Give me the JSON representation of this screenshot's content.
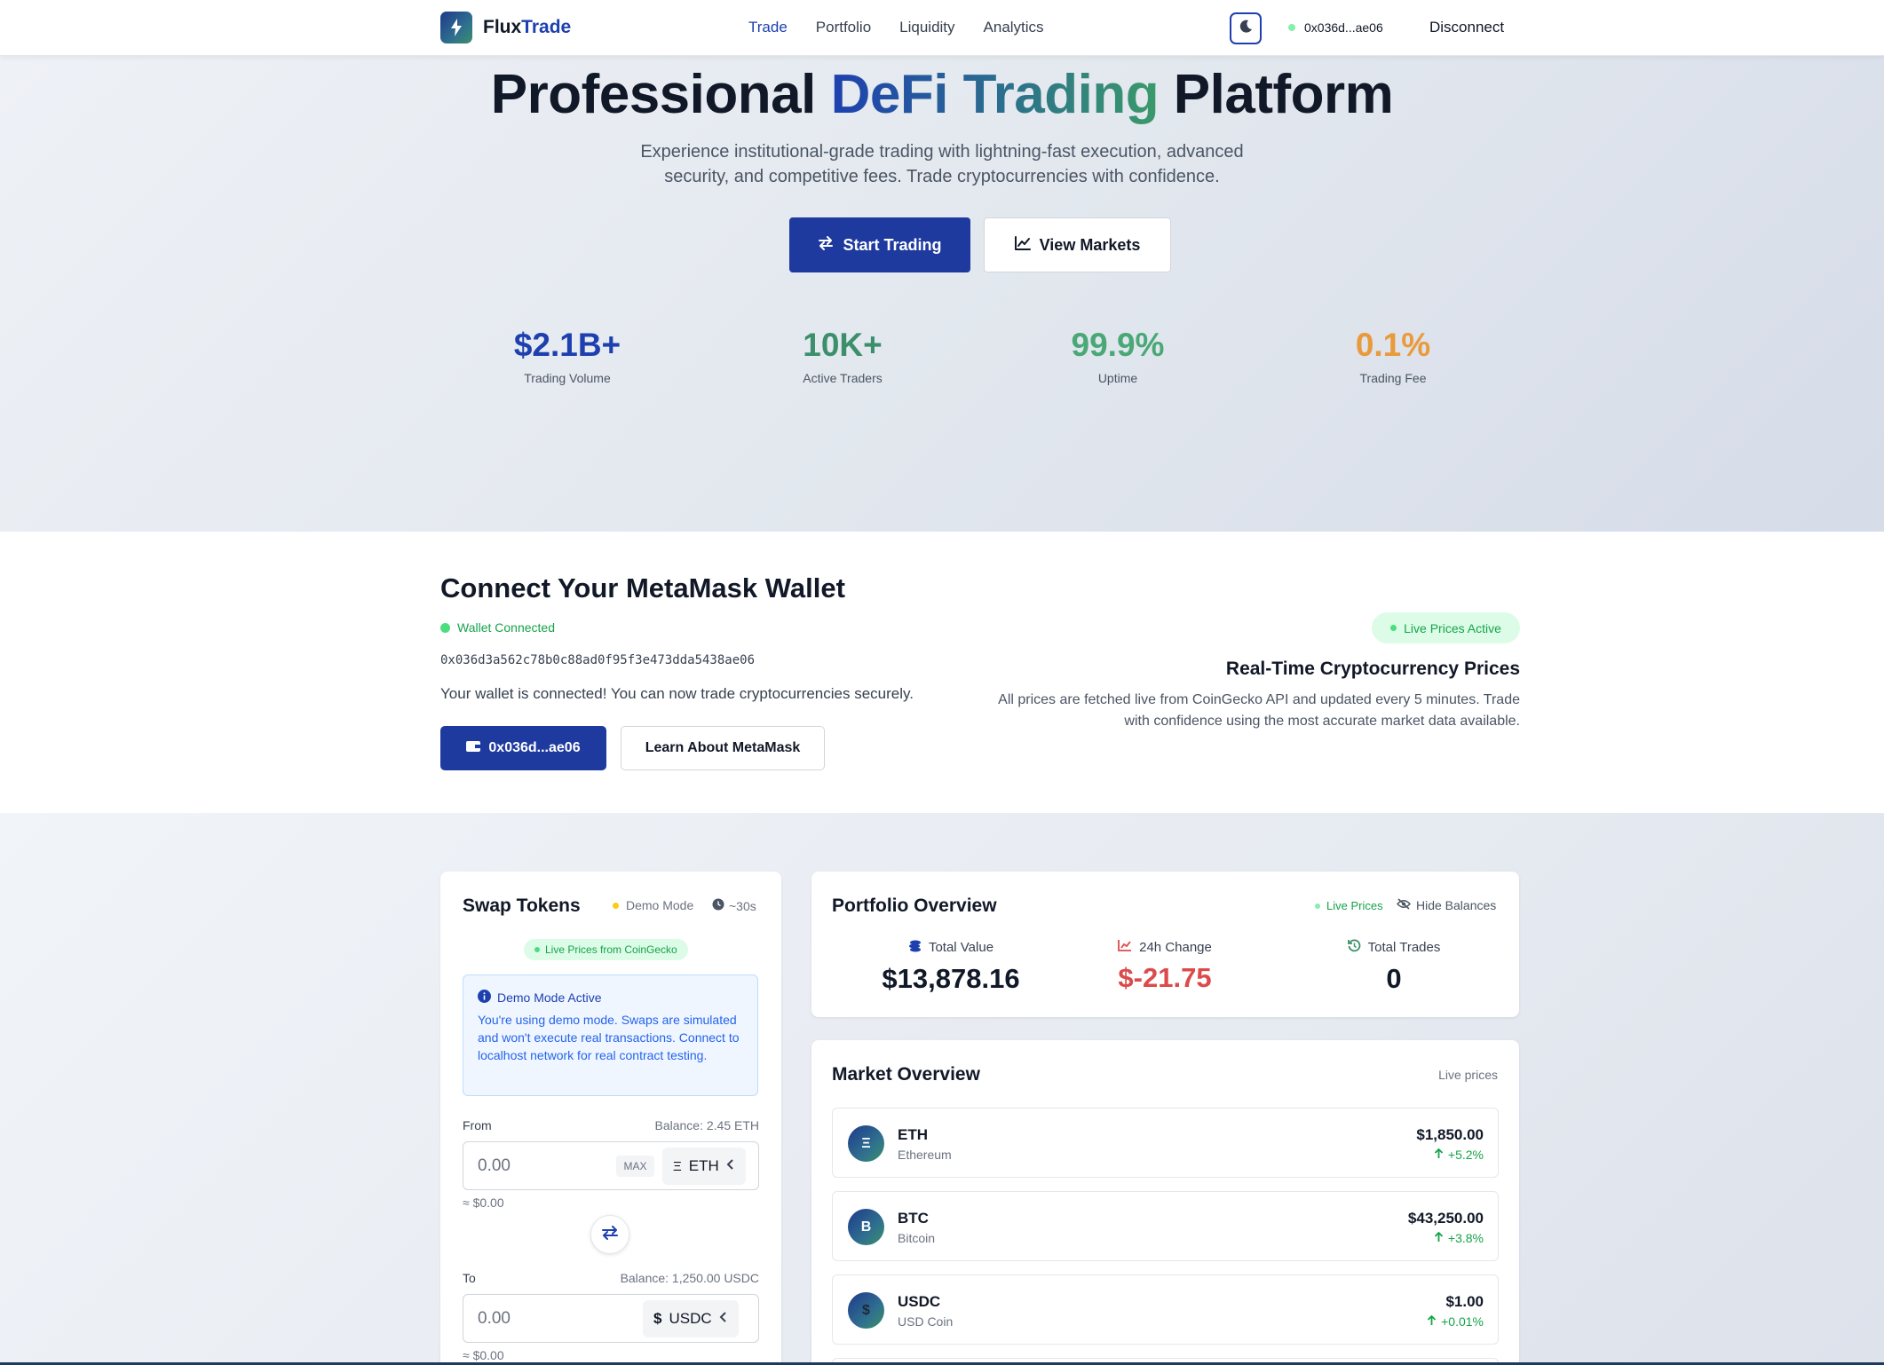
{
  "nav": {
    "brand_a": "Flux",
    "brand_b": "Trade",
    "links": [
      "Trade",
      "Portfolio",
      "Liquidity",
      "Analytics"
    ],
    "active_link": "Trade",
    "address": "0x036d...ae06",
    "disconnect": "Disconnect"
  },
  "hero": {
    "title_a": "Professional ",
    "title_grad": "DeFi Trading",
    "title_b": " Platform",
    "subtitle": "Experience institutional-grade trading with lightning-fast execution, advanced security, and competitive fees. Trade cryptocurrencies with confidence.",
    "primary_btn": "Start Trading",
    "secondary_btn": "View Markets",
    "stats": [
      {
        "value": "$2.1B+",
        "label": "Trading Volume",
        "color": "#1e40af"
      },
      {
        "value": "10K+",
        "label": "Active Traders",
        "color": "#3b8f6a"
      },
      {
        "value": "99.9%",
        "label": "Uptime",
        "color": "#4aa877"
      },
      {
        "value": "0.1%",
        "label": "Trading Fee",
        "color": "#e99a3a"
      }
    ]
  },
  "wallet": {
    "title": "Connect Your MetaMask Wallet",
    "status": "Wallet Connected",
    "address": "0x036d3a562c78b0c88ad0f95f3e473dda5438ae06",
    "message": "Your wallet is connected! You can now trade cryptocurrencies securely.",
    "btn_address": "0x036d...ae06",
    "btn_learn": "Learn About MetaMask",
    "live_pill": "Live Prices Active",
    "rt_title": "Real-Time Cryptocurrency Prices",
    "rt_sub": "All prices are fetched live from CoinGecko API and updated every 5 minutes. Trade with confidence using the most accurate market data available."
  },
  "swap": {
    "title": "Swap Tokens",
    "demo_tag": "Demo Mode",
    "time_tag": "~30s",
    "cg_pill": "Live Prices from CoinGecko",
    "info_head": "Demo Mode Active",
    "info_body": "You're using demo mode. Swaps are simulated and won't execute real transactions. Connect to localhost network for real contract testing.",
    "from_label": "From",
    "from_balance": "Balance: 2.45 ETH",
    "from_value": "0.00",
    "max_label": "MAX",
    "from_token": "ETH",
    "from_usd": "≈ $0.00",
    "to_label": "To",
    "to_balance": "Balance: 1,250.00 USDC",
    "to_value": "0.00",
    "to_token": "USDC",
    "to_usd": "≈ $0.00"
  },
  "portfolio": {
    "title": "Portfolio Overview",
    "live": "Live Prices",
    "hide": "Hide Balances",
    "stats": [
      {
        "label": "Total Value",
        "value": "$13,878.16",
        "color": "#111827"
      },
      {
        "label": "24h Change",
        "value": "$-21.75",
        "color": "#dc4b4b"
      },
      {
        "label": "Total Trades",
        "value": "0",
        "color": "#111827"
      }
    ]
  },
  "market": {
    "title": "Market Overview",
    "live": "Live prices",
    "rows": [
      {
        "icon": "Ξ",
        "symbol": "ETH",
        "name": "Ethereum",
        "price": "$1,850.00",
        "change": "+5.2%"
      },
      {
        "icon": "B",
        "symbol": "BTC",
        "name": "Bitcoin",
        "price": "$43,250.00",
        "change": "+3.8%"
      },
      {
        "icon": "$",
        "symbol": "USDC",
        "name": "USD Coin",
        "price": "$1.00",
        "change": "+0.01%"
      }
    ]
  }
}
